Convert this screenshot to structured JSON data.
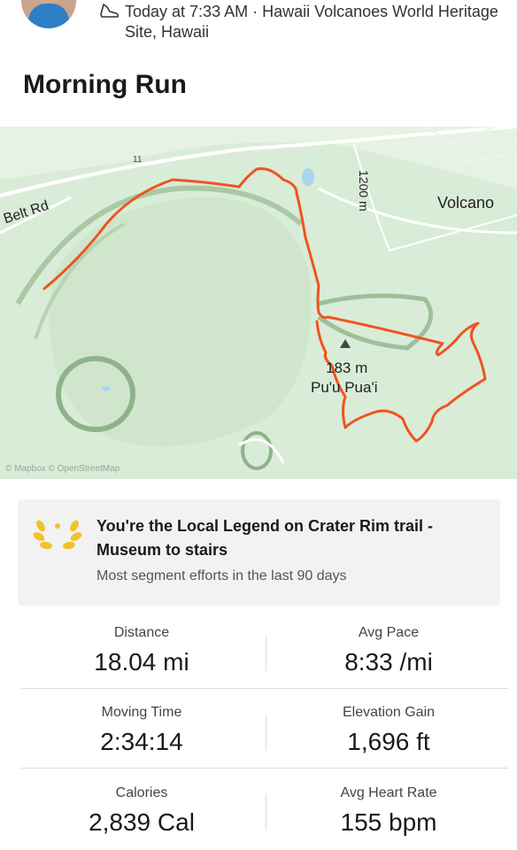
{
  "activity": {
    "meta_line1": "Today at 7:33 AM · Hawaii Volcanoes World Heritage",
    "meta_line2": "Site, Hawaii",
    "title": "Morning Run",
    "sport_icon": "running-shoe-icon"
  },
  "map": {
    "labels": {
      "belt_rd": "Belt Rd",
      "volcano": "Volcano",
      "contour": "1200 m",
      "elevation": "183 m",
      "peak": "Pu'u Pua'i",
      "road_number": "11"
    },
    "attribution": "© Mapbox © OpenStreetMap",
    "colors": {
      "route": "#f0531f",
      "land": "#d9ecd7",
      "road": "#ffffff"
    }
  },
  "local_legend": {
    "title": "You're the Local Legend on Crater Rim trail - Museum to stairs",
    "subtitle": "Most segment efforts in the last 90 days",
    "icon": "laurel-icon",
    "color": "#f2c12e"
  },
  "stats": [
    {
      "label": "Distance",
      "value": "18.04 mi"
    },
    {
      "label": "Avg Pace",
      "value": "8:33 /mi"
    },
    {
      "label": "Moving Time",
      "value": "2:34:14"
    },
    {
      "label": "Elevation Gain",
      "value": "1,696 ft"
    },
    {
      "label": "Calories",
      "value": "2,839 Cal"
    },
    {
      "label": "Avg Heart Rate",
      "value": "155 bpm"
    }
  ]
}
